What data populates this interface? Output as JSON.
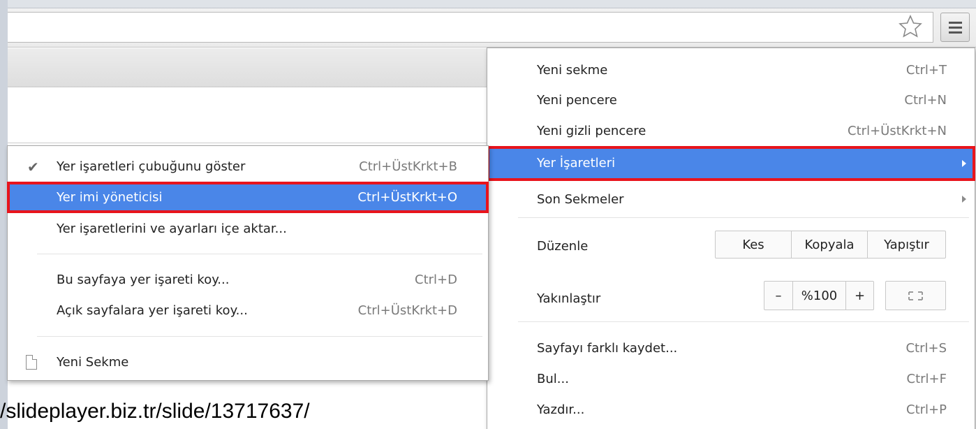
{
  "watermark": "/slideplayer.biz.tr/slide/13717637/",
  "icons": {
    "bookmark": "star-icon",
    "menu": "hamburger-menu-icon",
    "check": "✔",
    "fullscreen": "fullscreen-icon",
    "new_tab": "page-icon"
  },
  "colors": {
    "highlight": "#4a86e8",
    "outline": "#e8141c"
  },
  "main_menu": {
    "new_tab": {
      "label": "Yeni sekme",
      "shortcut": "Ctrl+T"
    },
    "new_window": {
      "label": "Yeni pencere",
      "shortcut": "Ctrl+N"
    },
    "incognito": {
      "label": "Yeni gizli pencere",
      "shortcut": "Ctrl+ÜstKrkt+N"
    },
    "bookmarks": {
      "label": "Yer İşaretleri"
    },
    "recent_tabs": {
      "label": "Son Sekmeler"
    },
    "edit": {
      "label": "Düzenle",
      "cut": "Kes",
      "copy": "Kopyala",
      "paste": "Yapıştır"
    },
    "zoom": {
      "label": "Yakınlaştır",
      "minus": "–",
      "value": "%100",
      "plus": "+"
    },
    "save_as": {
      "label": "Sayfayı farklı kaydet...",
      "shortcut": "Ctrl+S"
    },
    "find": {
      "label": "Bul...",
      "shortcut": "Ctrl+F"
    },
    "print": {
      "label": "Yazdır...",
      "shortcut": "Ctrl+P"
    }
  },
  "sub_menu": {
    "show_bar": {
      "label": "Yer işaretleri çubuğunu göster",
      "shortcut": "Ctrl+ÜstKrkt+B"
    },
    "manager": {
      "label": "Yer imi yöneticisi",
      "shortcut": "Ctrl+ÜstKrkt+O"
    },
    "import": {
      "label": "Yer işaretlerini ve ayarları içe aktar..."
    },
    "bookmark_page": {
      "label": "Bu sayfaya yer işareti koy...",
      "shortcut": "Ctrl+D"
    },
    "bookmark_open": {
      "label": "Açık sayfalara yer işareti koy...",
      "shortcut": "Ctrl+ÜstKrkt+D"
    },
    "new_tab_bookmark": {
      "label": "Yeni Sekme"
    }
  }
}
